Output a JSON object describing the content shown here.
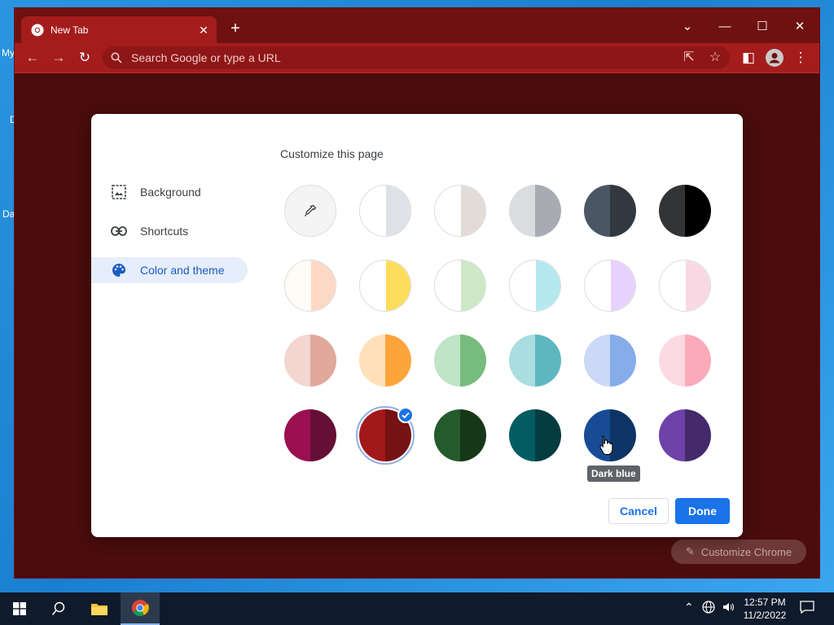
{
  "desktop": {
    "labels": [
      "My",
      "D",
      "Da"
    ]
  },
  "browser": {
    "tab_title": "New Tab",
    "tab_close": "✕",
    "new_tab": "+",
    "window_controls": {
      "dropdown": "⌄",
      "minimize": "—",
      "maximize": "☐",
      "close": "✕"
    },
    "omnibox_placeholder": "Search Google or type a URL",
    "customize_chrome": "Customize Chrome"
  },
  "dialog": {
    "title": "Customize this page",
    "nav": [
      {
        "label": "Background",
        "icon": "image-icon",
        "active": false
      },
      {
        "label": "Shortcuts",
        "icon": "link-icon",
        "active": false
      },
      {
        "label": "Color and theme",
        "icon": "palette-icon",
        "active": true
      }
    ],
    "swatches": [
      [
        {
          "name": "custom-color",
          "l": "#f4f4f5",
          "r": "#f4f4f5"
        },
        {
          "name": "default",
          "l": "#ffffff",
          "r": "#dee1e6"
        },
        {
          "name": "warm-grey",
          "l": "#ffffff",
          "r": "#e3dbd7"
        },
        {
          "name": "cool-grey",
          "l": "#dadce0",
          "r": "#a9abb3"
        },
        {
          "name": "grey",
          "l": "#4a5663",
          "r": "#31383f"
        },
        {
          "name": "black",
          "l": "#333436",
          "r": "#000000"
        }
      ],
      [
        {
          "name": "beige-white",
          "l": "#fffbf5",
          "r": "#fdd8c4"
        },
        {
          "name": "yellow-white",
          "l": "#ffffff",
          "r": "#fedd5d"
        },
        {
          "name": "green-white",
          "l": "#ffffff",
          "r": "#cce8c5"
        },
        {
          "name": "light-teal-white",
          "l": "#ffffff",
          "r": "#b5e8ef"
        },
        {
          "name": "light-purple-white",
          "l": "#ffffff",
          "r": "#e7d2fd"
        },
        {
          "name": "pink-white",
          "l": "#ffffff",
          "r": "#f8d9e3"
        }
      ],
      [
        {
          "name": "beige",
          "l": "#f2d6cf",
          "r": "#e1a89c"
        },
        {
          "name": "orange",
          "l": "#ffe0b8",
          "r": "#fda53b"
        },
        {
          "name": "light-green",
          "l": "#c0e4c8",
          "r": "#77bb7d"
        },
        {
          "name": "light-teal",
          "l": "#a9dddf",
          "r": "#5eb7c0"
        },
        {
          "name": "light-blue",
          "l": "#cbd9f7",
          "r": "#86acea"
        },
        {
          "name": "light-pink",
          "l": "#fcdae3",
          "r": "#fbaab9"
        }
      ],
      [
        {
          "name": "dark-pink",
          "l": "#9a1050",
          "r": "#650f36"
        },
        {
          "name": "dark-red",
          "l": "#a3181b",
          "r": "#751214"
        },
        {
          "name": "dark-green",
          "l": "#245a2c",
          "r": "#163819"
        },
        {
          "name": "dark-teal",
          "l": "#045c63",
          "r": "#043c40"
        },
        {
          "name": "dark-blue",
          "l": "#174c95",
          "r": "#0e3466"
        },
        {
          "name": "purple",
          "l": "#6e42a8",
          "r": "#452a6b"
        }
      ]
    ],
    "selected": "dark-red",
    "tooltip": "Dark blue",
    "cancel": "Cancel",
    "done": "Done"
  },
  "taskbar": {
    "time": "12:57 PM",
    "date": "11/2/2022"
  }
}
